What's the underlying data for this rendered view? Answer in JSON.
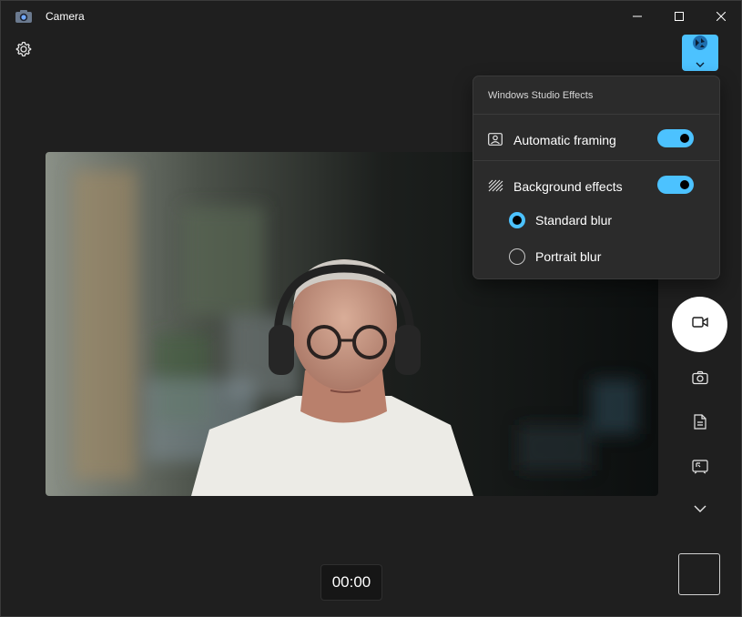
{
  "window": {
    "title": "Camera",
    "app_icon": "camera-app-icon",
    "controls": [
      "minimize-icon",
      "maximize-icon",
      "close-icon"
    ]
  },
  "toolbar": {
    "settings_icon": "gear-icon",
    "effects_icon": "studio-effects-icon"
  },
  "effects_flyout": {
    "title": "Windows Studio Effects",
    "automatic_framing": {
      "label": "Automatic framing",
      "enabled": true,
      "icon": "framing-icon"
    },
    "background_effects": {
      "label": "Background effects",
      "enabled": true,
      "icon": "background-effects-icon",
      "options": [
        {
          "label": "Standard blur",
          "selected": true
        },
        {
          "label": "Portrait blur",
          "selected": false
        }
      ]
    }
  },
  "side_controls": {
    "record_mode": "video-camera-icon",
    "photo_mode": "camera-icon",
    "document_mode": "document-icon",
    "barcode_mode": "scan-icon",
    "more": "chevron-down-icon"
  },
  "timer": "00:00",
  "colors": {
    "accent": "#4cc2ff",
    "background": "#1f1f1f",
    "flyout": "#2b2b2b"
  }
}
